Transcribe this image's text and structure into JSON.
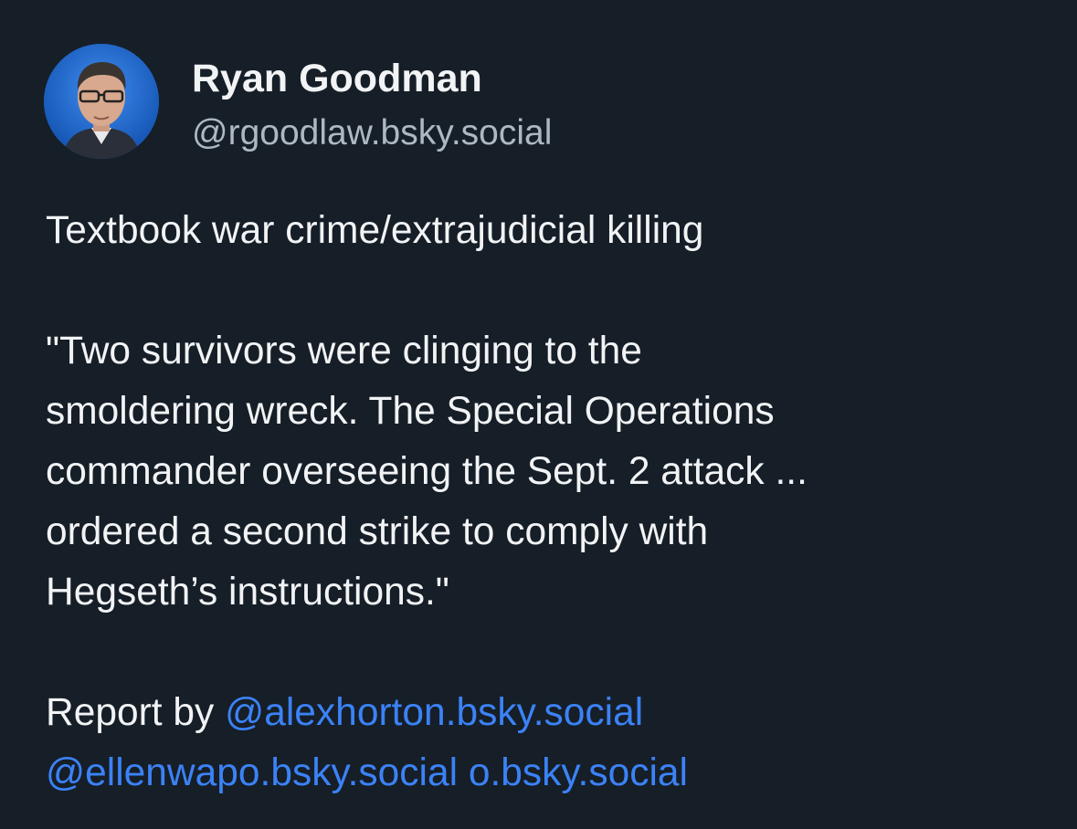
{
  "author": {
    "name": "Ryan Goodman",
    "handle": "@rgoodlaw.bsky.social",
    "avatar_icon": "profile-photo"
  },
  "post": {
    "line1": "Textbook war crime/extrajudicial killing",
    "quote_lines": [
      "\"Two survivors were clinging to the",
      "smoldering wreck. The Special Operations",
      "commander overseeing the Sept. 2 attack ...",
      "ordered a second strike to comply with",
      "Hegseth’s instructions.\""
    ],
    "report_prefix": "Report by ",
    "mentions": [
      "@alexhorton.bsky.social",
      "@ellenwapo.bsky.social o.bsky.social"
    ]
  },
  "colors": {
    "background": "#161e27",
    "text": "#f1f3f5",
    "handle": "#aeb8c4",
    "link": "#3b82f6"
  }
}
